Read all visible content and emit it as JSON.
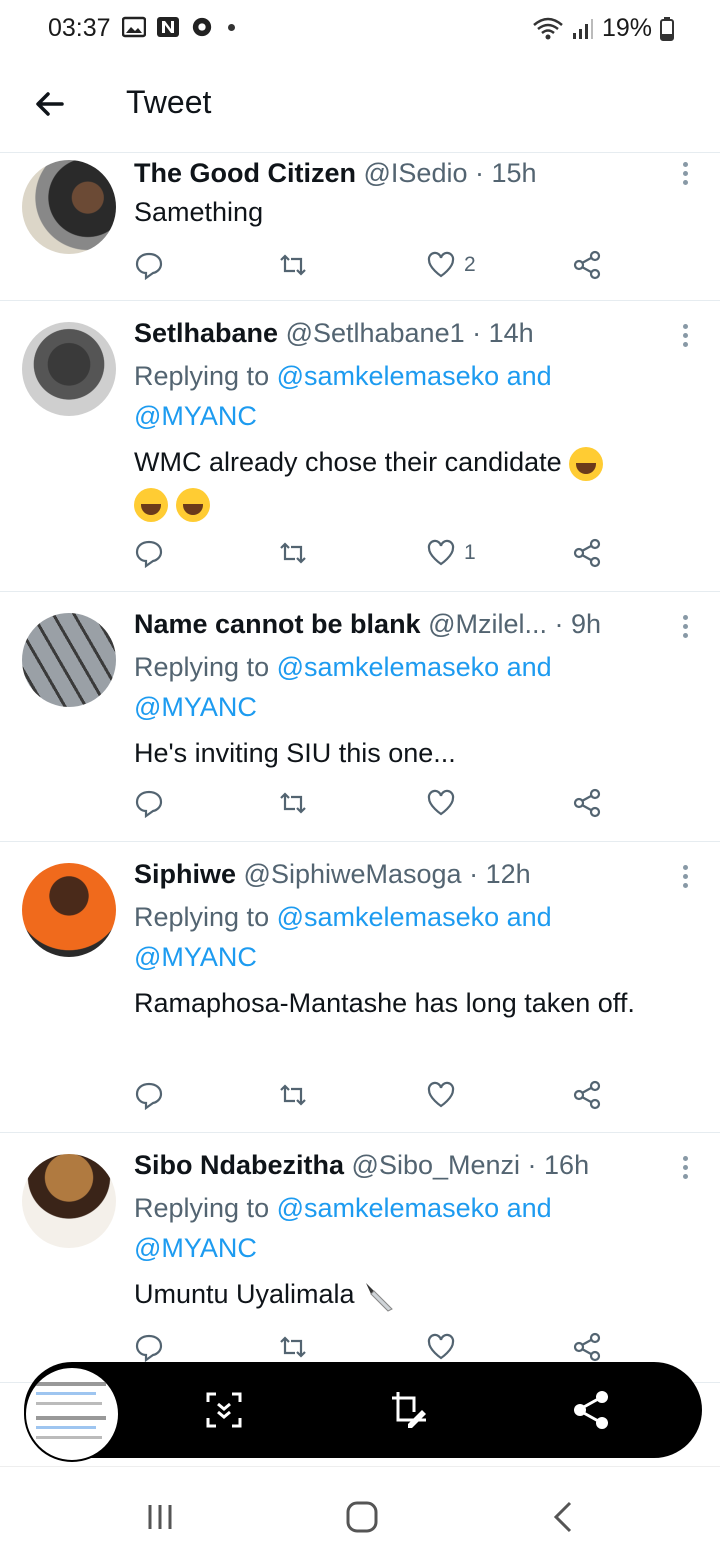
{
  "status_bar": {
    "time": "03:37",
    "battery": "19%"
  },
  "header": {
    "title": "Tweet"
  },
  "tweets": [
    {
      "name": "The Good Citizen",
      "handle": "@ISedio",
      "time": "· 15h",
      "replying": false,
      "text": "Samething",
      "likes": "2"
    },
    {
      "name": "Setlhabane",
      "handle": "@Setlhabane1",
      "time": "· 14h",
      "replying": true,
      "replying_prefix": "Replying to",
      "replying_to_1": "@samkelemaseko and",
      "replying_to_2": "@MYANC",
      "text": "WMC already chose their candidate",
      "likes": "1"
    },
    {
      "name": "Name cannot be blank",
      "handle": "@Mzilel...",
      "time": "· 9h",
      "replying": true,
      "replying_prefix": "Replying to",
      "replying_to_1": "@samkelemaseko and",
      "replying_to_2": "@MYANC",
      "text": "He's inviting SIU this one...",
      "likes": ""
    },
    {
      "name": "Siphiwe",
      "handle": "@SiphiweMasoga",
      "time": "· 12h",
      "replying": true,
      "replying_prefix": "Replying to",
      "replying_to_1": "@samkelemaseko and",
      "replying_to_2": "@MYANC",
      "text": "Ramaphosa-Mantashe has long taken off.",
      "likes": ""
    },
    {
      "name": "Sibo Ndabezitha",
      "handle": "@Sibo_Menzi",
      "time": "· 16h",
      "replying": true,
      "replying_prefix": "Replying to",
      "replying_to_1": "@samkelemaseko and",
      "replying_to_2": "@MYANC",
      "text": "Umuntu Uyalimala",
      "likes": ""
    }
  ],
  "icons": {
    "back": "arrow-left-icon",
    "more": "more-vertical-icon",
    "reply": "reply-icon",
    "retweet": "retweet-icon",
    "like": "heart-icon",
    "share": "share-icon",
    "scroll_capture": "scroll-capture-icon",
    "edit": "crop-edit-icon",
    "toolbar_share": "share-icon"
  },
  "colors": {
    "link": "#1d9bf0",
    "secondary_text": "#536471",
    "toolbar": "#000000"
  }
}
